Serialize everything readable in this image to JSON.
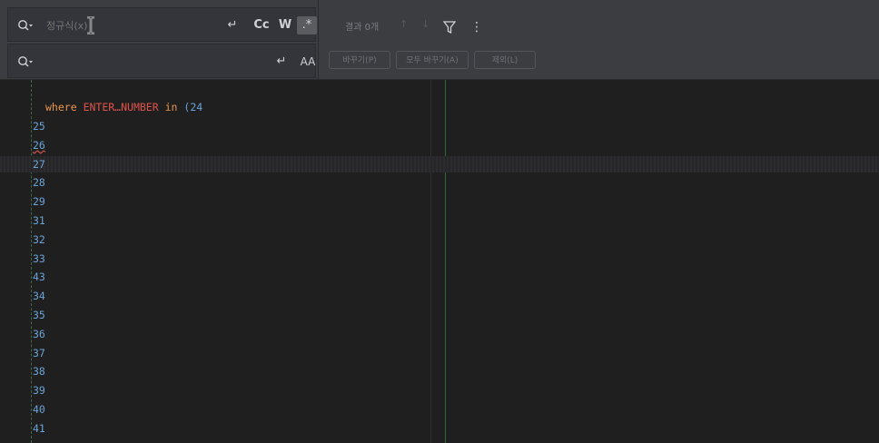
{
  "find_bar": {
    "find_placeholder": "정규식(x)",
    "find_value": "",
    "replace_value": "",
    "options": {
      "wrap": "↵",
      "case": "Cc",
      "word": "W",
      "regex": ".*"
    },
    "preserve_case": "AA",
    "replace_wrap": "↵",
    "results_text": "결과 0개",
    "nav_up": "↑",
    "nav_down": "↓",
    "more": "⋮",
    "buttons": {
      "replace": "바꾸기(P)",
      "replace_all": "모두 바꾸기(A)",
      "exclude": "제외(L)"
    }
  },
  "editor": {
    "first_line": {
      "keyword": "where",
      "identifier": "ENTER…NUMBER",
      "keyword2": "in",
      "rest": "(24"
    },
    "numbers": [
      "25",
      "26",
      "27",
      "28",
      "29",
      "31",
      "32",
      "33",
      "43",
      "34",
      "35",
      "36",
      "37",
      "38",
      "39",
      "40",
      "41"
    ]
  },
  "colors": {
    "panel": "#3b3d40",
    "editor_bg": "#1f1f1f",
    "keyword": "#e8964c",
    "identifier": "#e0524b",
    "number": "#6aa3d8",
    "guide": "#2b6a38"
  }
}
